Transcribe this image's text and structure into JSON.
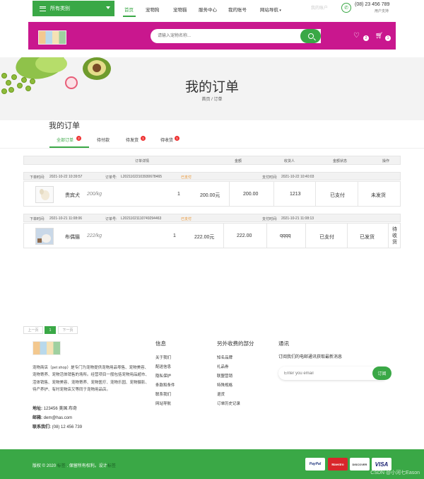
{
  "topnav": {
    "category_label": "所有类别",
    "items": [
      "首页",
      "宠物狗",
      "宠物猫",
      "服务中心",
      "我的账号",
      "网站导航"
    ],
    "faint_link": "我的账户",
    "phone": "(08) 23 456 789",
    "support": "用户支持"
  },
  "header": {
    "search_placeholder": "请输入宠物名称...",
    "wishlist_count": "2",
    "cart_count": "1",
    "bg_color": "#c9178e"
  },
  "hero": {
    "title": "我的订单",
    "breadcrumb_home": "首页",
    "breadcrumb_sep": "/",
    "breadcrumb_current": "订单"
  },
  "orders": {
    "title": "我的订单",
    "tabs": [
      {
        "label": "全部订单",
        "badge": "2"
      },
      {
        "label": "待付款",
        "badge": ""
      },
      {
        "label": "待发货",
        "badge": "1"
      },
      {
        "label": "待收货",
        "badge": "1"
      }
    ],
    "columns": [
      "订单详情",
      "金额",
      "收货人",
      "金额状态",
      "操作"
    ],
    "list": [
      {
        "created_label": "下单时间:",
        "created": "2021-10-22 10:39:57",
        "no_label": "订单号:",
        "no": "L20211022103930678465",
        "status": "已支付",
        "paid_label": "支付时间:",
        "paid": "2021-10-22 10:40:03",
        "name": "贵宾犬",
        "price": "200/kg",
        "qty": "1",
        "subtotal": "200.00元",
        "amount": "200.00",
        "receiver": "1213",
        "pay_status": "已支付",
        "action": "未发货"
      },
      {
        "created_label": "下单时间:",
        "created": "2021-10-21 11:08:06",
        "no_label": "订单号:",
        "no": "L20211021110749294463",
        "status": "已支付",
        "paid_label": "支付时间:",
        "paid": "2021-10-21 11:08:13",
        "name": "布偶猫",
        "price": "222/kg",
        "qty": "1",
        "subtotal": "222.00元",
        "amount": "222.00",
        "receiver": "qqqq",
        "pay_status": "已支付",
        "action1": "已发货",
        "action2": [
          "待",
          "收",
          "货"
        ]
      }
    ]
  },
  "pagination": {
    "prev": "上一页",
    "current": "1",
    "next": "下一页"
  },
  "footer": {
    "description": "宠物商店（pet shop）是专门为宠物提供宠物用品零售、宠物美容、宠物寄养、宠物活体销售的场所。经营项目一般包括宠物用品超市、活体销售、宠物美容、宠物寄养、宠物医疗、宠物乐园、宠物摄影、待产养护、有时宠物店又等同于宠物用品店。",
    "address_label": "地址:",
    "address": "123456 美国.布奇",
    "mail_label": "邮箱:",
    "mail": "dem@has.com",
    "tel_label": "联系我们:",
    "tel": "(08) 12 456 739",
    "info": {
      "title": "信息",
      "links": [
        "关于我们",
        "配送信息",
        "隐私保护",
        "条款和条件",
        "联系我们",
        "网站导航"
      ]
    },
    "extras": {
      "title": "另外收费的部分",
      "links": [
        "知名品牌",
        "礼品券",
        "联盟营销",
        "特殊规格",
        "退货",
        "订单历史记录"
      ]
    },
    "news": {
      "title": "通讯",
      "text": "订阅我们的电邮通讯获取最新消息",
      "placeholder": "Enter you email",
      "button": "订阅"
    },
    "copyright_a": "版权 © 2020 ",
    "copyright_b": "标签",
    "copyright_c": " . 保留所有权利。设计",
    "copyright_d": "标签",
    "cards": [
      "PayPal",
      "Maestro",
      "DISCOVER",
      "VISA"
    ],
    "watermark": "CSDN @小河七Eason"
  },
  "colors": {
    "primary": "#3aa846",
    "magenta": "#c9178e",
    "badge": "#e33333",
    "paid": "#e8902b"
  }
}
